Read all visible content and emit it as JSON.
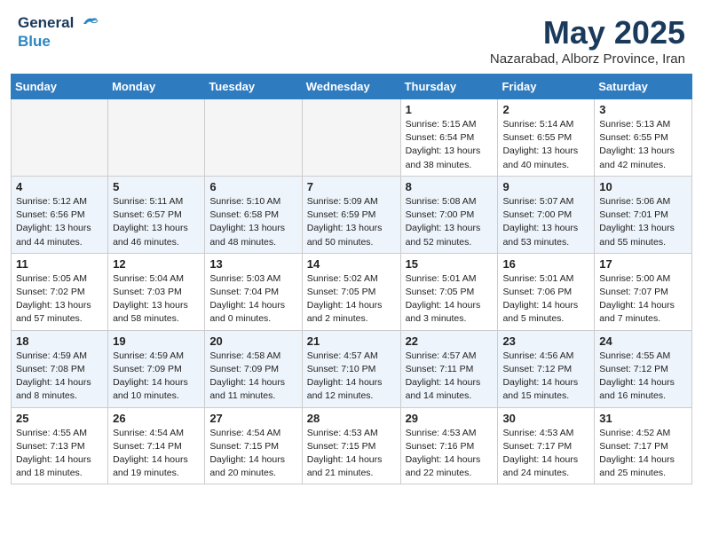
{
  "header": {
    "logo_line1": "General",
    "logo_line2": "Blue",
    "month": "May 2025",
    "location": "Nazarabad, Alborz Province, Iran"
  },
  "weekdays": [
    "Sunday",
    "Monday",
    "Tuesday",
    "Wednesday",
    "Thursday",
    "Friday",
    "Saturday"
  ],
  "weeks": [
    [
      {
        "day": "",
        "info": ""
      },
      {
        "day": "",
        "info": ""
      },
      {
        "day": "",
        "info": ""
      },
      {
        "day": "",
        "info": ""
      },
      {
        "day": "1",
        "info": "Sunrise: 5:15 AM\nSunset: 6:54 PM\nDaylight: 13 hours\nand 38 minutes."
      },
      {
        "day": "2",
        "info": "Sunrise: 5:14 AM\nSunset: 6:55 PM\nDaylight: 13 hours\nand 40 minutes."
      },
      {
        "day": "3",
        "info": "Sunrise: 5:13 AM\nSunset: 6:55 PM\nDaylight: 13 hours\nand 42 minutes."
      }
    ],
    [
      {
        "day": "4",
        "info": "Sunrise: 5:12 AM\nSunset: 6:56 PM\nDaylight: 13 hours\nand 44 minutes."
      },
      {
        "day": "5",
        "info": "Sunrise: 5:11 AM\nSunset: 6:57 PM\nDaylight: 13 hours\nand 46 minutes."
      },
      {
        "day": "6",
        "info": "Sunrise: 5:10 AM\nSunset: 6:58 PM\nDaylight: 13 hours\nand 48 minutes."
      },
      {
        "day": "7",
        "info": "Sunrise: 5:09 AM\nSunset: 6:59 PM\nDaylight: 13 hours\nand 50 minutes."
      },
      {
        "day": "8",
        "info": "Sunrise: 5:08 AM\nSunset: 7:00 PM\nDaylight: 13 hours\nand 52 minutes."
      },
      {
        "day": "9",
        "info": "Sunrise: 5:07 AM\nSunset: 7:00 PM\nDaylight: 13 hours\nand 53 minutes."
      },
      {
        "day": "10",
        "info": "Sunrise: 5:06 AM\nSunset: 7:01 PM\nDaylight: 13 hours\nand 55 minutes."
      }
    ],
    [
      {
        "day": "11",
        "info": "Sunrise: 5:05 AM\nSunset: 7:02 PM\nDaylight: 13 hours\nand 57 minutes."
      },
      {
        "day": "12",
        "info": "Sunrise: 5:04 AM\nSunset: 7:03 PM\nDaylight: 13 hours\nand 58 minutes."
      },
      {
        "day": "13",
        "info": "Sunrise: 5:03 AM\nSunset: 7:04 PM\nDaylight: 14 hours\nand 0 minutes."
      },
      {
        "day": "14",
        "info": "Sunrise: 5:02 AM\nSunset: 7:05 PM\nDaylight: 14 hours\nand 2 minutes."
      },
      {
        "day": "15",
        "info": "Sunrise: 5:01 AM\nSunset: 7:05 PM\nDaylight: 14 hours\nand 3 minutes."
      },
      {
        "day": "16",
        "info": "Sunrise: 5:01 AM\nSunset: 7:06 PM\nDaylight: 14 hours\nand 5 minutes."
      },
      {
        "day": "17",
        "info": "Sunrise: 5:00 AM\nSunset: 7:07 PM\nDaylight: 14 hours\nand 7 minutes."
      }
    ],
    [
      {
        "day": "18",
        "info": "Sunrise: 4:59 AM\nSunset: 7:08 PM\nDaylight: 14 hours\nand 8 minutes."
      },
      {
        "day": "19",
        "info": "Sunrise: 4:59 AM\nSunset: 7:09 PM\nDaylight: 14 hours\nand 10 minutes."
      },
      {
        "day": "20",
        "info": "Sunrise: 4:58 AM\nSunset: 7:09 PM\nDaylight: 14 hours\nand 11 minutes."
      },
      {
        "day": "21",
        "info": "Sunrise: 4:57 AM\nSunset: 7:10 PM\nDaylight: 14 hours\nand 12 minutes."
      },
      {
        "day": "22",
        "info": "Sunrise: 4:57 AM\nSunset: 7:11 PM\nDaylight: 14 hours\nand 14 minutes."
      },
      {
        "day": "23",
        "info": "Sunrise: 4:56 AM\nSunset: 7:12 PM\nDaylight: 14 hours\nand 15 minutes."
      },
      {
        "day": "24",
        "info": "Sunrise: 4:55 AM\nSunset: 7:12 PM\nDaylight: 14 hours\nand 16 minutes."
      }
    ],
    [
      {
        "day": "25",
        "info": "Sunrise: 4:55 AM\nSunset: 7:13 PM\nDaylight: 14 hours\nand 18 minutes."
      },
      {
        "day": "26",
        "info": "Sunrise: 4:54 AM\nSunset: 7:14 PM\nDaylight: 14 hours\nand 19 minutes."
      },
      {
        "day": "27",
        "info": "Sunrise: 4:54 AM\nSunset: 7:15 PM\nDaylight: 14 hours\nand 20 minutes."
      },
      {
        "day": "28",
        "info": "Sunrise: 4:53 AM\nSunset: 7:15 PM\nDaylight: 14 hours\nand 21 minutes."
      },
      {
        "day": "29",
        "info": "Sunrise: 4:53 AM\nSunset: 7:16 PM\nDaylight: 14 hours\nand 22 minutes."
      },
      {
        "day": "30",
        "info": "Sunrise: 4:53 AM\nSunset: 7:17 PM\nDaylight: 14 hours\nand 24 minutes."
      },
      {
        "day": "31",
        "info": "Sunrise: 4:52 AM\nSunset: 7:17 PM\nDaylight: 14 hours\nand 25 minutes."
      }
    ]
  ]
}
